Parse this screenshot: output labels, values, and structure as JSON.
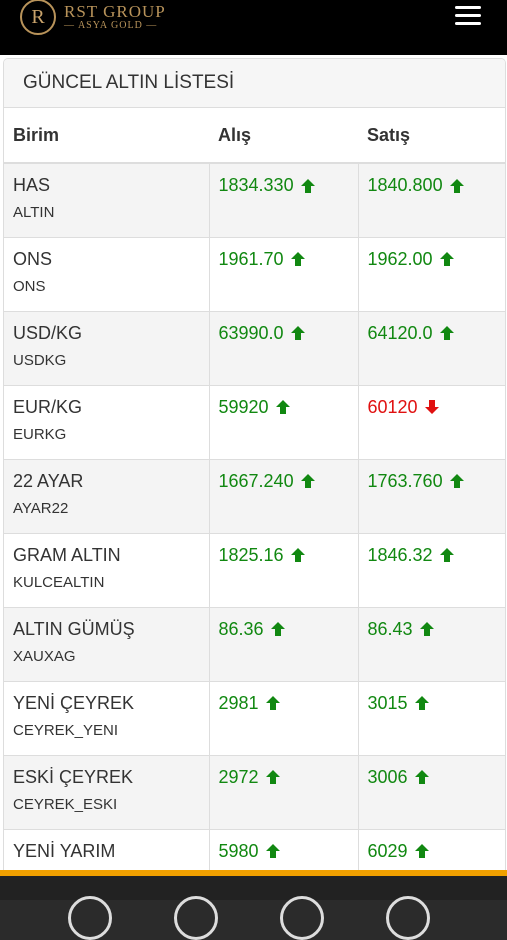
{
  "header": {
    "logo_mark": "R",
    "logo_title": "RST GROUP",
    "logo_subtitle": "— ASYA GOLD —"
  },
  "card": {
    "title": "GÜNCEL ALTIN LİSTESİ"
  },
  "table": {
    "columns": [
      "Birim",
      "Alış",
      "Satış"
    ],
    "rows": [
      {
        "name": "HAS",
        "code": "ALTIN",
        "buy": "1834.330",
        "buy_dir": "up",
        "sell": "1840.800",
        "sell_dir": "up"
      },
      {
        "name": "ONS",
        "code": "ONS",
        "buy": "1961.70",
        "buy_dir": "up",
        "sell": "1962.00",
        "sell_dir": "up"
      },
      {
        "name": "USD/KG",
        "code": "USDKG",
        "buy": "63990.0",
        "buy_dir": "up",
        "sell": "64120.0",
        "sell_dir": "up"
      },
      {
        "name": "EUR/KG",
        "code": "EURKG",
        "buy": "59920",
        "buy_dir": "up",
        "sell": "60120",
        "sell_dir": "down"
      },
      {
        "name": "22 AYAR",
        "code": "AYAR22",
        "buy": "1667.240",
        "buy_dir": "up",
        "sell": "1763.760",
        "sell_dir": "up"
      },
      {
        "name": "GRAM ALTIN",
        "code": "KULCEALTIN",
        "buy": "1825.16",
        "buy_dir": "up",
        "sell": "1846.32",
        "sell_dir": "up"
      },
      {
        "name": "ALTIN GÜMÜŞ",
        "code": "XAUXAG",
        "buy": "86.36",
        "buy_dir": "up",
        "sell": "86.43",
        "sell_dir": "up"
      },
      {
        "name": "YENİ ÇEYREK",
        "code": "CEYREK_YENI",
        "buy": "2981",
        "buy_dir": "up",
        "sell": "3015",
        "sell_dir": "up"
      },
      {
        "name": "ESKİ ÇEYREK",
        "code": "CEYREK_ESKI",
        "buy": "2972",
        "buy_dir": "up",
        "sell": "3006",
        "sell_dir": "up"
      },
      {
        "name": "YENİ YARIM",
        "code": "",
        "buy": "5980",
        "buy_dir": "up",
        "sell": "6029",
        "sell_dir": "up"
      }
    ]
  },
  "colors": {
    "up": "#118811",
    "down": "#e01010",
    "accent": "#f0a000",
    "logo_gold": "#b8935a"
  }
}
